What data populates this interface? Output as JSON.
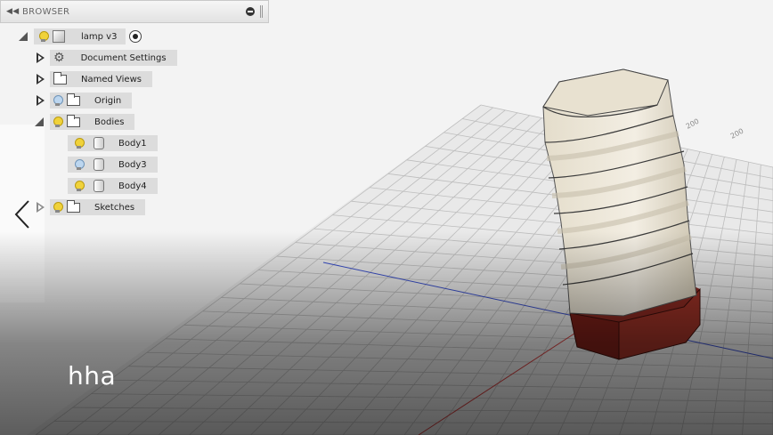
{
  "browser": {
    "title": "BROWSER",
    "component": "lamp v3",
    "items": [
      {
        "label": "Document Settings"
      },
      {
        "label": "Named Views"
      },
      {
        "label": "Origin"
      },
      {
        "label": "Bodies"
      },
      {
        "label": "Body1"
      },
      {
        "label": "Body3"
      },
      {
        "label": "Body4"
      },
      {
        "label": "Sketches"
      }
    ]
  },
  "grid_labels": {
    "a": "200",
    "b": "200"
  },
  "caption": "hha",
  "colors": {
    "panel_bg": "#dcdcdc",
    "model_body": "#ece6d8",
    "model_base": "#7a1f18",
    "axis_x": "#d04040",
    "axis_y": "#3a4fc8"
  }
}
